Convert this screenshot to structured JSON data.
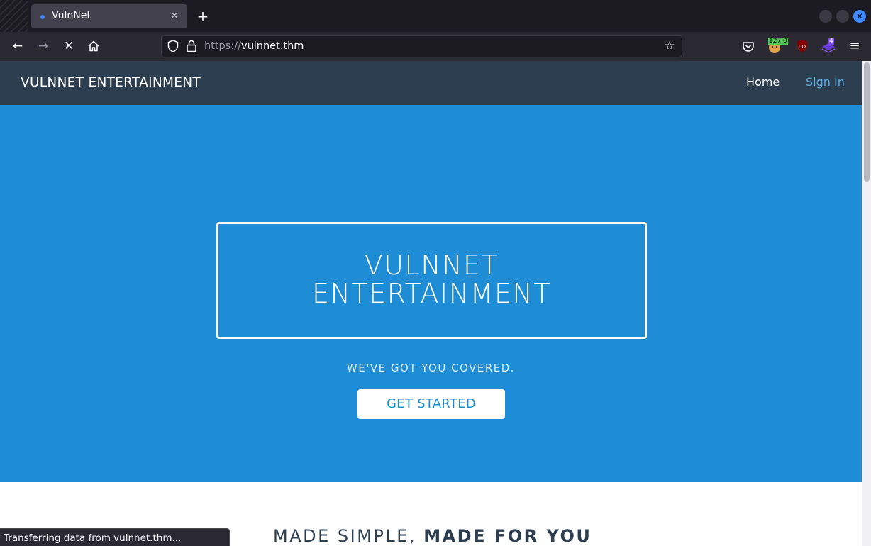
{
  "browser": {
    "tab_title": "VulnNet",
    "tab_close": "×",
    "new_tab": "+",
    "url_scheme": "https://",
    "url_host": "vulnnet.thm",
    "extension_badge_1": "127.0",
    "extension_badge_2": "4",
    "status_text": "Transferring data from vulnnet.thm..."
  },
  "site": {
    "brand": "VULNNET ENTERTAINMENT",
    "nav": {
      "home": "Home",
      "sign_in": "Sign In"
    },
    "hero": {
      "title_line1": "VULNNET",
      "title_line2": "ENTERTAINMENT",
      "tagline": "WE'VE GOT YOU COVERED.",
      "cta": "GET STARTED"
    },
    "section": {
      "title_light": "MADE SIMPLE, ",
      "title_bold": "MADE FOR YOU"
    }
  },
  "colors": {
    "hero_bg": "#1f8dd6",
    "navbar_bg": "#2c3e50",
    "sign_in_link": "#5dade2",
    "browser_accent": "#3d8bff"
  }
}
